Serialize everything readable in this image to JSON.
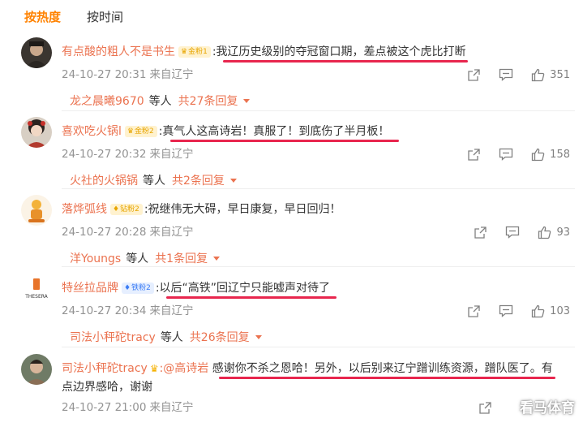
{
  "tabs": {
    "hot": "按热度",
    "time": "按时间"
  },
  "colors": {
    "accent_orange": "#ff8200",
    "username": "#eb7350",
    "underline": "#e8264e",
    "meta_gray": "#939393"
  },
  "comments": [
    {
      "username": "有点酸的粗人不是书生",
      "badge": "金粉1",
      "text": ":我辽历史级别的夺冠窗口期，差点被这个虎比打断",
      "timestamp": "24-10-27 20:31",
      "source": "来自辽宁",
      "likes": "351",
      "sub_user": "龙之晨曦9670",
      "sub_text": "等人",
      "sub_count": "共27条回复"
    },
    {
      "username": "喜欢吃火锅l",
      "badge": "金粉2",
      "text": ":真气人这高诗岩！真服了！到底伤了半月板！",
      "timestamp": "24-10-27 20:32",
      "source": "来自辽宁",
      "likes": "158",
      "sub_user": "火社的火锅锅",
      "sub_text": "等人",
      "sub_count": "共2条回复"
    },
    {
      "username": "落烨弧线",
      "badge": "钻粉2",
      "text": ":祝继伟无大碍，早日康复，早日回归！",
      "timestamp": "24-10-27 20:28",
      "source": "来自辽宁",
      "likes": "93",
      "sub_user": "洋Youngs",
      "sub_text": "等人",
      "sub_count": "共1条回复"
    },
    {
      "username": "特丝拉品牌",
      "badge": "铁粉2",
      "text": ":以后“高铁”回辽宁只能嘘声对待了",
      "timestamp": "24-10-27 20:34",
      "source": "来自辽宁",
      "likes": "103",
      "avatar_text": "THESERA",
      "sub_user": "司法小秤砣tracy",
      "sub_text": "等人",
      "sub_count": "共26条回复"
    },
    {
      "username": "司法小秤砣tracy",
      "mention": ":@高诗岩",
      "text": " 感谢你不杀之恩哈！另外，以后别来辽宁蹭训练资源，蹭队医了。有点边界感哈，谢谢",
      "timestamp": "24-10-27 21:00",
      "source": "来自辽宁"
    }
  ],
  "watermark": "看马体育"
}
